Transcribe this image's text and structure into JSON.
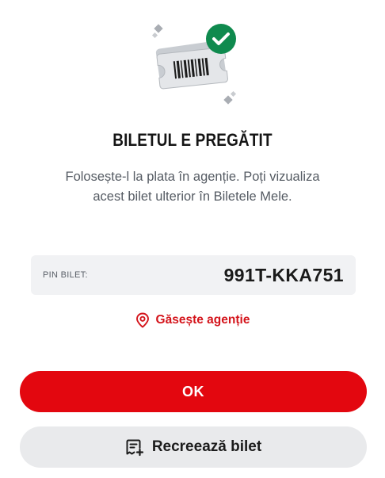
{
  "success": {
    "title": "BILETUL E PREGĂTIT",
    "message_line1": "Folosește-l la plata în agenție. Poți vizualiza",
    "message_line2": "acest bilet ulterior în Biletele Mele."
  },
  "pin": {
    "label": "PIN BILET:",
    "value": "991T-KKA751"
  },
  "find_agency": {
    "label": "Găsește agenție",
    "icon": "location-pin-icon"
  },
  "buttons": {
    "ok_label": "OK",
    "recreate_label": "Recreează bilet",
    "recreate_icon": "ticket-add-icon"
  },
  "colors": {
    "accent_red": "#e3070f",
    "link_red": "#d4141b",
    "check_green": "#0f8a4e",
    "pin_box_bg": "#f1f2f4",
    "secondary_button_bg": "#e9eaec"
  }
}
